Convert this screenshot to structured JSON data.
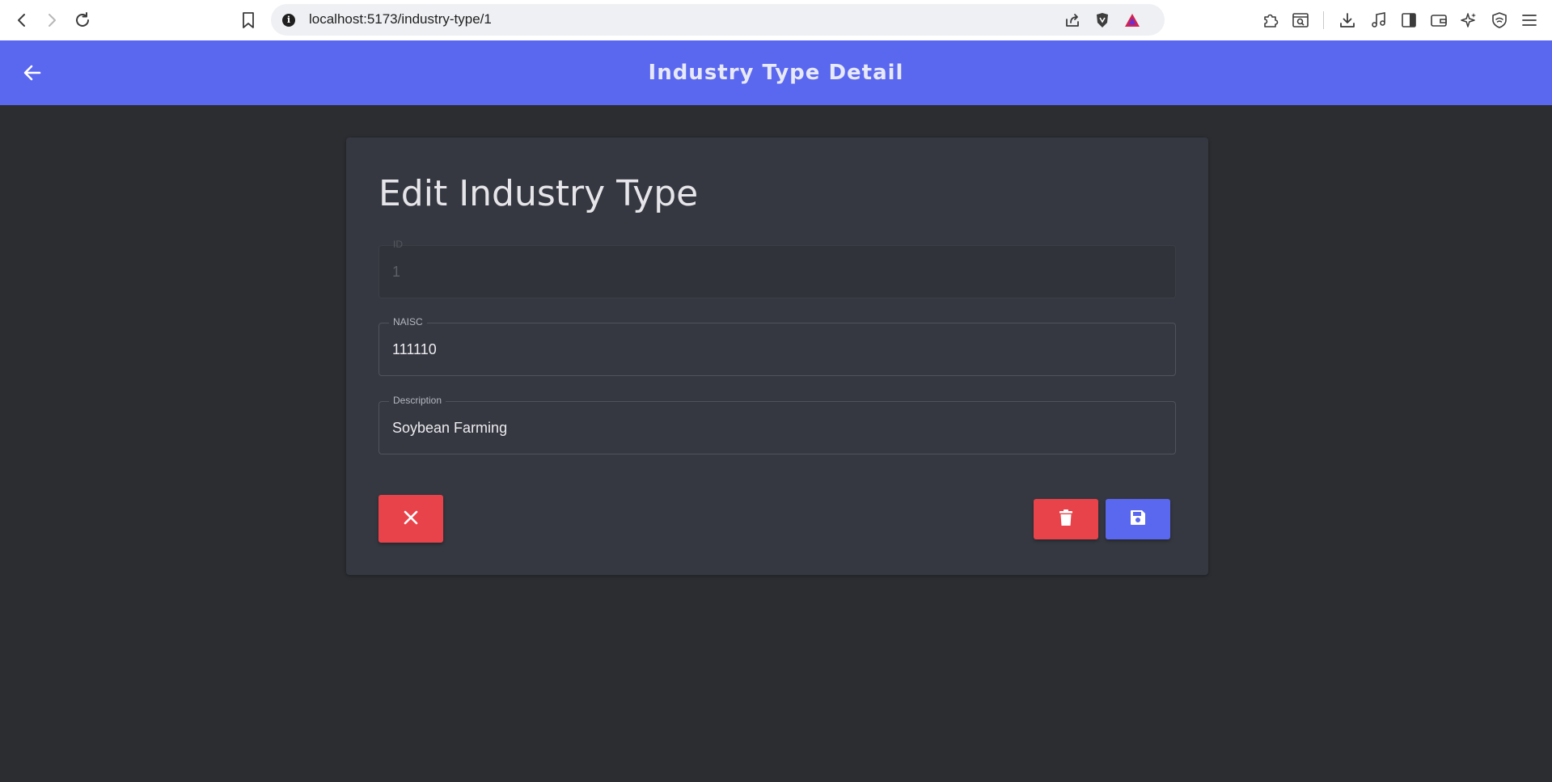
{
  "browser": {
    "url": "localhost:5173/industry-type/1",
    "info_glyph": "i",
    "icons": [
      "back-icon",
      "forward-icon",
      "reload-icon",
      "bookmark-icon",
      "share-icon",
      "brave-shield-icon",
      "brave-rewards-icon",
      "extensions-icon",
      "search-page-icon",
      "downloads-icon",
      "media-icon",
      "sidebar-icon",
      "wallet-icon",
      "leo-ai-icon",
      "vpn-icon",
      "menu-icon"
    ]
  },
  "appbar": {
    "title": "Industry Type Detail",
    "background": "#5a67ef"
  },
  "form": {
    "heading": "Edit Industry Type",
    "fields": [
      {
        "label": "ID",
        "value": "1",
        "disabled": true
      },
      {
        "label": "NAISC",
        "value": "111110",
        "disabled": false
      },
      {
        "label": "Description",
        "value": "Soybean Farming",
        "disabled": false
      }
    ],
    "buttons": {
      "cancel": {
        "icon": "close-icon",
        "color": "#e8434a"
      },
      "delete": {
        "icon": "trash-icon",
        "color": "#e8434a"
      },
      "save": {
        "icon": "save-icon",
        "color": "#5a67ef"
      }
    }
  }
}
